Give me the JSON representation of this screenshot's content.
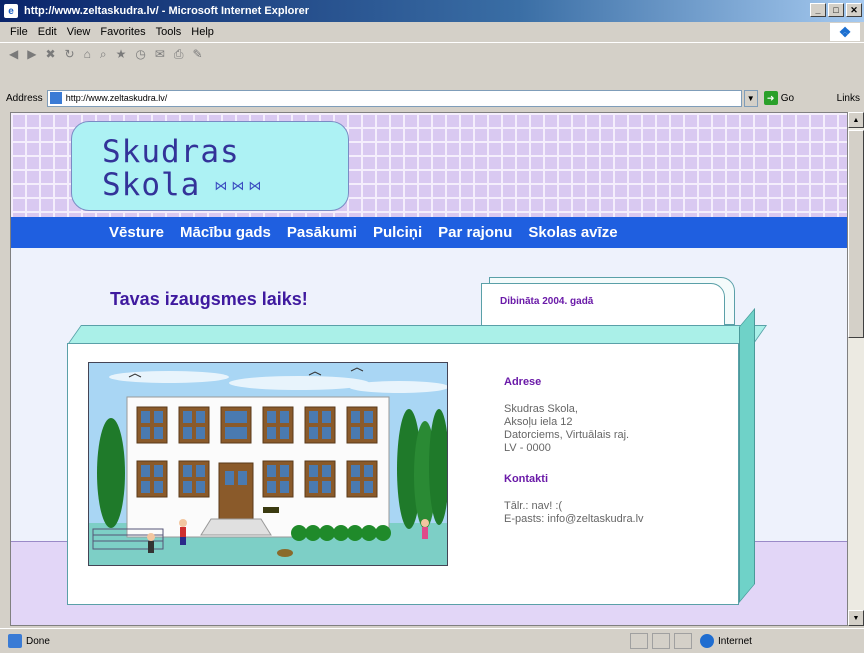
{
  "browser": {
    "title": "http://www.zeltaskudra.lv/ - Microsoft Internet Explorer",
    "menu": [
      "File",
      "Edit",
      "View",
      "Favorites",
      "Tools",
      "Help"
    ],
    "address_label": "Address",
    "address_value": "http://www.zeltaskudra.lv/",
    "go_label": "Go",
    "links_label": "Links",
    "status_text": "Done",
    "zone_text": "Internet"
  },
  "site": {
    "logo_line1": "Skudras",
    "logo_line2": "Skola",
    "logo_bugs": "⋈⋈⋈",
    "nav": [
      "Vēsture",
      "Mācību gads",
      "Pasākumi",
      "Pulciņi",
      "Par rajonu",
      "Skolas avīze"
    ],
    "tagline": "Tavas izaugsmes laiks!",
    "founded": "Dibināta 2004. gadā",
    "address_heading": "Adrese",
    "address_lines": [
      "Skudras Skola,",
      "Aksoļu iela 12",
      "Datorciems, Virtuālais raj.",
      "LV - 0000"
    ],
    "contacts_heading": "Kontakti",
    "phone": "Tālr.: nav! :(",
    "email": "E-pasts: info@zeltaskudra.lv"
  },
  "colors": {
    "nav_bg": "#1f5fe0",
    "logo_bg": "#adf2f4",
    "accent_purple": "#6a1aa8",
    "card_border": "#5aa0a8"
  }
}
